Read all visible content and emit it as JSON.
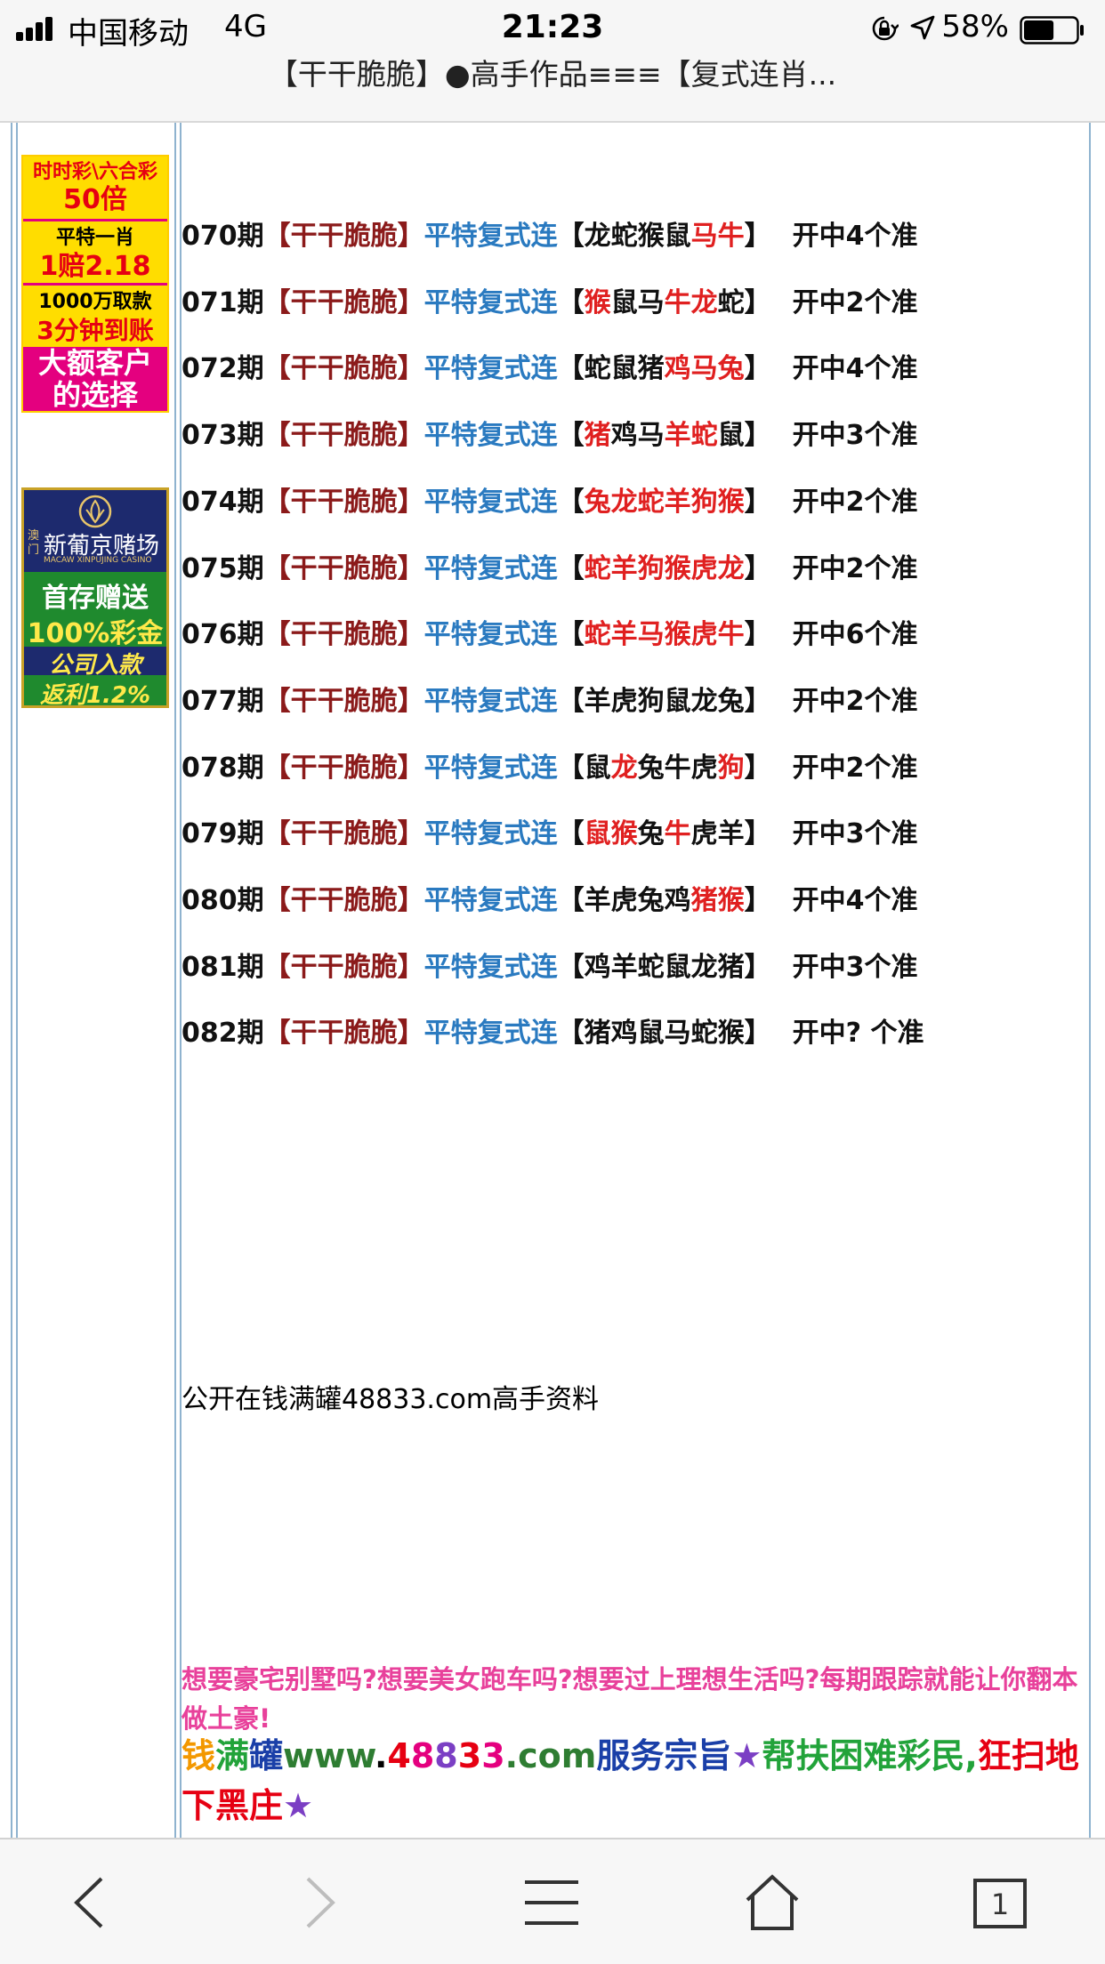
{
  "status_bar": {
    "carrier": "中国移动",
    "network": "4G",
    "time": "21:23",
    "battery": "58%",
    "battery_level": 0.58,
    "icons": [
      "signal-icon",
      "orientation-lock-icon",
      "location-icon",
      "battery-icon"
    ]
  },
  "page": {
    "title": "【干干脆脆】●高手作品≡≡≡【复式连肖..."
  },
  "ads": {
    "lottery": {
      "line1": "时时彩\\六合彩",
      "line2": "50倍",
      "line3": "平特一肖",
      "line4": "1赔2.18",
      "line5": "1000万取款",
      "line6": "3分钟到账",
      "line7": "大额客户",
      "line8": "的选择"
    },
    "casino": {
      "side": "澳门",
      "title": "新葡京赌场",
      "subtitle": "MACAW XINPUJING CASINO",
      "line1": "首存赠送",
      "line2": "100%彩金",
      "line3": "公司入款",
      "line4": "返利1.2%"
    }
  },
  "records": [
    {
      "period": "070期",
      "brand": "【干干脆脆】",
      "type": "平特复式连",
      "open": "【",
      "zodiac": [
        [
          "龙蛇猴鼠",
          false
        ],
        [
          "马牛",
          true
        ]
      ],
      "close": "】",
      "result": "开中4个准"
    },
    {
      "period": "071期",
      "brand": "【干干脆脆】",
      "type": "平特复式连",
      "open": "【",
      "zodiac": [
        [
          "猴",
          true
        ],
        [
          "鼠马",
          false
        ],
        [
          "牛龙",
          true
        ],
        [
          "蛇",
          false
        ]
      ],
      "close": "】",
      "result": "开中2个准"
    },
    {
      "period": "072期",
      "brand": "【干干脆脆】",
      "type": "平特复式连",
      "open": "【",
      "zodiac": [
        [
          "蛇鼠猪",
          false
        ],
        [
          "鸡马兔",
          true
        ]
      ],
      "close": "】",
      "result": "开中4个准"
    },
    {
      "period": "073期",
      "brand": "【干干脆脆】",
      "type": "平特复式连",
      "open": "【",
      "zodiac": [
        [
          "猪",
          true
        ],
        [
          "鸡马",
          false
        ],
        [
          "羊蛇",
          true
        ],
        [
          "鼠",
          false
        ]
      ],
      "close": "】",
      "result": "开中3个准"
    },
    {
      "period": "074期",
      "brand": "【干干脆脆】",
      "type": "平特复式连",
      "open": "【",
      "zodiac": [
        [
          "兔龙蛇羊狗猴",
          true
        ]
      ],
      "close": "】",
      "result": "开中2个准"
    },
    {
      "period": "075期",
      "brand": "【干干脆脆】",
      "type": "平特复式连",
      "open": "【",
      "zodiac": [
        [
          "蛇羊狗猴虎龙",
          true
        ]
      ],
      "close": "】",
      "result": "开中2个准"
    },
    {
      "period": "076期",
      "brand": "【干干脆脆】",
      "type": "平特复式连",
      "open": "【",
      "zodiac": [
        [
          "蛇羊马猴虎牛",
          true
        ]
      ],
      "close": "】",
      "result": "开中6个准"
    },
    {
      "period": "077期",
      "brand": "【干干脆脆】",
      "type": "平特复式连",
      "open": "【",
      "zodiac": [
        [
          "羊虎狗鼠龙兔",
          false
        ]
      ],
      "close": "】",
      "result": "开中2个准"
    },
    {
      "period": "078期",
      "brand": "【干干脆脆】",
      "type": "平特复式连",
      "open": "【",
      "zodiac": [
        [
          "鼠",
          false
        ],
        [
          "龙",
          true
        ],
        [
          "兔牛虎",
          false
        ],
        [
          "狗",
          true
        ]
      ],
      "close": "】",
      "result": "开中2个准"
    },
    {
      "period": "079期",
      "brand": "【干干脆脆】",
      "type": "平特复式连",
      "open": "【",
      "zodiac": [
        [
          "鼠猴",
          true
        ],
        [
          "兔",
          false
        ],
        [
          "牛",
          true
        ],
        [
          "虎羊",
          false
        ]
      ],
      "close": "】",
      "result": "开中3个准"
    },
    {
      "period": "080期",
      "brand": "【干干脆脆】",
      "type": "平特复式连",
      "open": "【",
      "zodiac": [
        [
          "羊虎兔鸡",
          false
        ],
        [
          "猪猴",
          true
        ]
      ],
      "close": "】",
      "result": "开中4个准"
    },
    {
      "period": "081期",
      "brand": "【干干脆脆】",
      "type": "平特复式连",
      "open": "【",
      "zodiac": [
        [
          "鸡羊蛇鼠龙猪",
          false
        ]
      ],
      "close": "】",
      "result": "开中3个准"
    },
    {
      "period": "082期",
      "brand": "【干干脆脆】",
      "type": "平特复式连",
      "open": "【",
      "zodiac": [
        [
          "猪鸡鼠马蛇猴",
          false
        ]
      ],
      "close": "】",
      "result": "开中? 个准"
    }
  ],
  "footer_note": "公开在钱满罐48833.com高手资料",
  "promo1": "想要豪宅别墅吗?想要美女跑车吗?想要过上理想生活吗?每期跟踪就能让你翻本做土豪!",
  "promo2": [
    [
      "钱",
      "#f39800"
    ],
    [
      "满",
      "#22a33a"
    ],
    [
      "罐",
      "#1a3fa8"
    ],
    [
      "www",
      "#2e7d32"
    ],
    [
      ".",
      "#000000"
    ],
    [
      "4",
      "#e60012"
    ],
    [
      "8",
      "#e4007f"
    ],
    [
      "8",
      "#7b3fc4"
    ],
    [
      "3",
      "#e60012"
    ],
    [
      "3",
      "#e4007f"
    ],
    [
      ".com",
      "#2e7d32"
    ],
    [
      "服务宗旨",
      "#1a3fa8"
    ],
    [
      "★",
      "#7b3fc4"
    ],
    [
      "帮扶困难彩民,",
      "#22a33a"
    ],
    [
      "狂扫地下黑庄",
      "#e60012"
    ],
    [
      "★",
      "#7b3fc4"
    ]
  ],
  "toolbar": {
    "tab_count": "1",
    "icons": [
      "back-icon",
      "forward-icon",
      "menu-icon",
      "home-icon",
      "tabs-icon"
    ]
  }
}
